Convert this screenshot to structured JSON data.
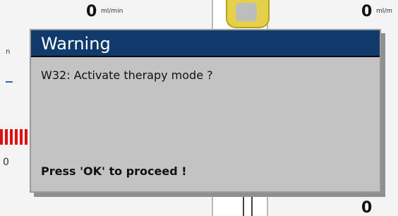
{
  "background": {
    "left_value": "0",
    "left_unit": "ml/min",
    "right_value": "0",
    "right_unit": "ml/m",
    "bottom_right_value": "0",
    "edge_letter": "n",
    "edge_digit": "0",
    "accent_red": "#e01010",
    "accent_yellow": "#e4d04a"
  },
  "dialog": {
    "title": "Warning",
    "message": "W32: Activate therapy mode ?",
    "hint": "Press 'OK' to proceed !",
    "title_bar_color": "#0f3a6b",
    "body_color": "#c3c3c3"
  }
}
